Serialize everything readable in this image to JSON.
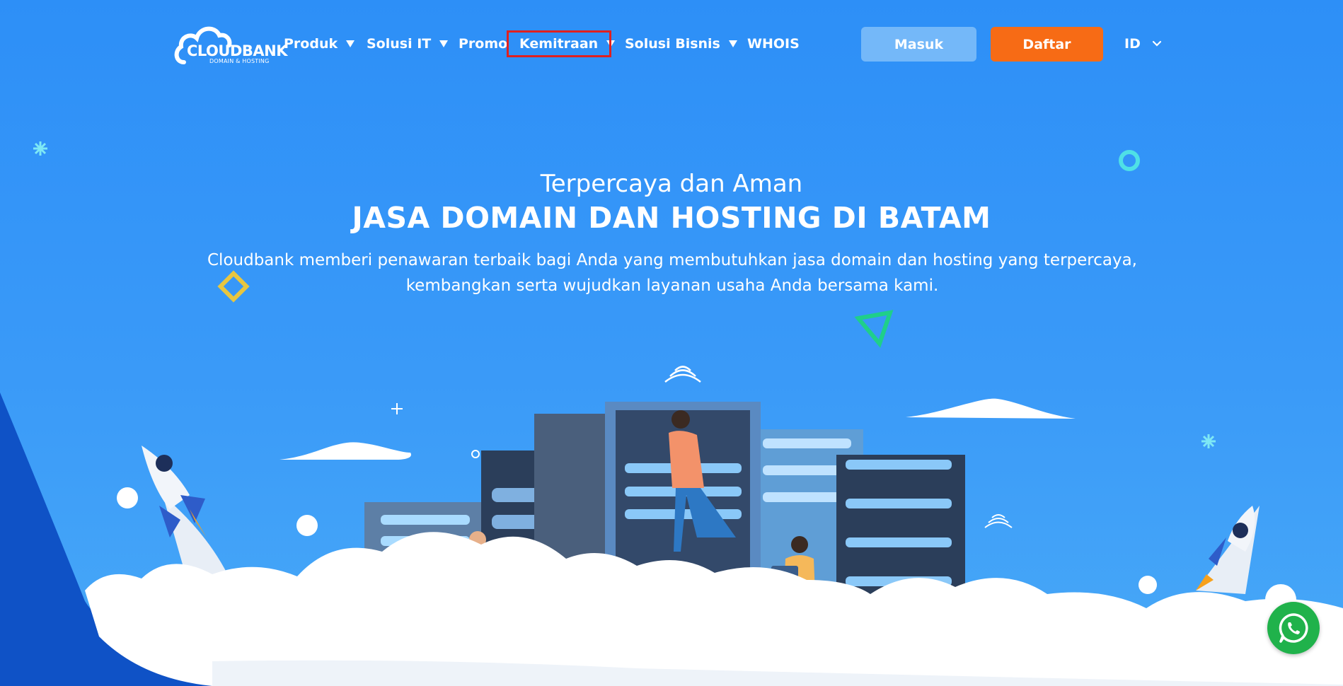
{
  "brand": {
    "name": "CLOUDBANK",
    "tagline": "DOMAIN & HOSTING"
  },
  "nav": {
    "items": [
      {
        "label": "Produk",
        "has_dropdown": true
      },
      {
        "label": "Solusi IT",
        "has_dropdown": true
      },
      {
        "label": "Promo",
        "has_dropdown": false
      },
      {
        "label": "Kemitraan",
        "has_dropdown": true,
        "highlighted": true
      },
      {
        "label": "Solusi Bisnis",
        "has_dropdown": true
      },
      {
        "label": "WHOIS",
        "has_dropdown": false
      }
    ]
  },
  "auth": {
    "login_label": "Masuk",
    "register_label": "Daftar"
  },
  "language": {
    "selected": "ID"
  },
  "hero": {
    "subtitle": "Terpercaya dan Aman",
    "title": "JASA DOMAIN DAN HOSTING DI BATAM",
    "description_line1": "Cloudbank memberi penawaran terbaik bagi Anda yang membutuhkan jasa domain dan hosting yang terpercaya,",
    "description_line2": "kembangkan serta wujudkan layanan usaha Anda bersama kami."
  },
  "icons": {
    "whatsapp": "whatsapp-icon",
    "chevron": "chevron-down-icon",
    "caret": "caret-down-icon"
  },
  "colors": {
    "background": "#3394f7",
    "register_button": "#f76b15",
    "login_button": "#74b8f9",
    "highlight_border": "#e0201f",
    "whatsapp": "#20b24b",
    "accent_dark_blue": "#0f52c6"
  }
}
